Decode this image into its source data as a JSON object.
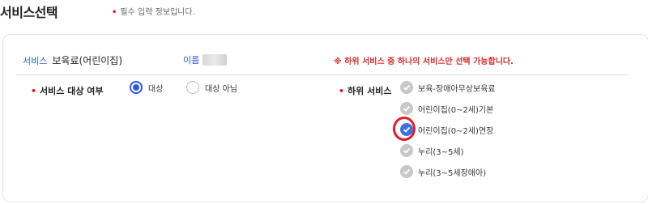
{
  "page": {
    "title": "서비스선택",
    "required_note": "필수 입력 정보입니다."
  },
  "service": {
    "label": "서비스",
    "name": "보육료(어린이집)",
    "person_label": "이름",
    "notice": "※ 하위 서비스 중 하나의 서비스만 선택 가능합니다."
  },
  "target_field": {
    "label": "서비스 대상 여부",
    "options": [
      {
        "label": "대상",
        "selected": true
      },
      {
        "label": "대상 아님",
        "selected": false
      }
    ]
  },
  "sub_services": {
    "label": "하위 서비스",
    "items": [
      {
        "label": "보육-장애아무상보육료",
        "checked": false
      },
      {
        "label": "어린이집(0~2세)기본",
        "checked": false
      },
      {
        "label": "어린이집(0~2세)연장",
        "checked": true
      },
      {
        "label": "누리(3~5세)",
        "checked": false
      },
      {
        "label": "누리(3~5세장애아)",
        "checked": false
      }
    ]
  },
  "colors": {
    "accent": "#2b5bd7",
    "required": "#d11111",
    "notice": "#d62a2a",
    "highlight": "#e31b23"
  }
}
